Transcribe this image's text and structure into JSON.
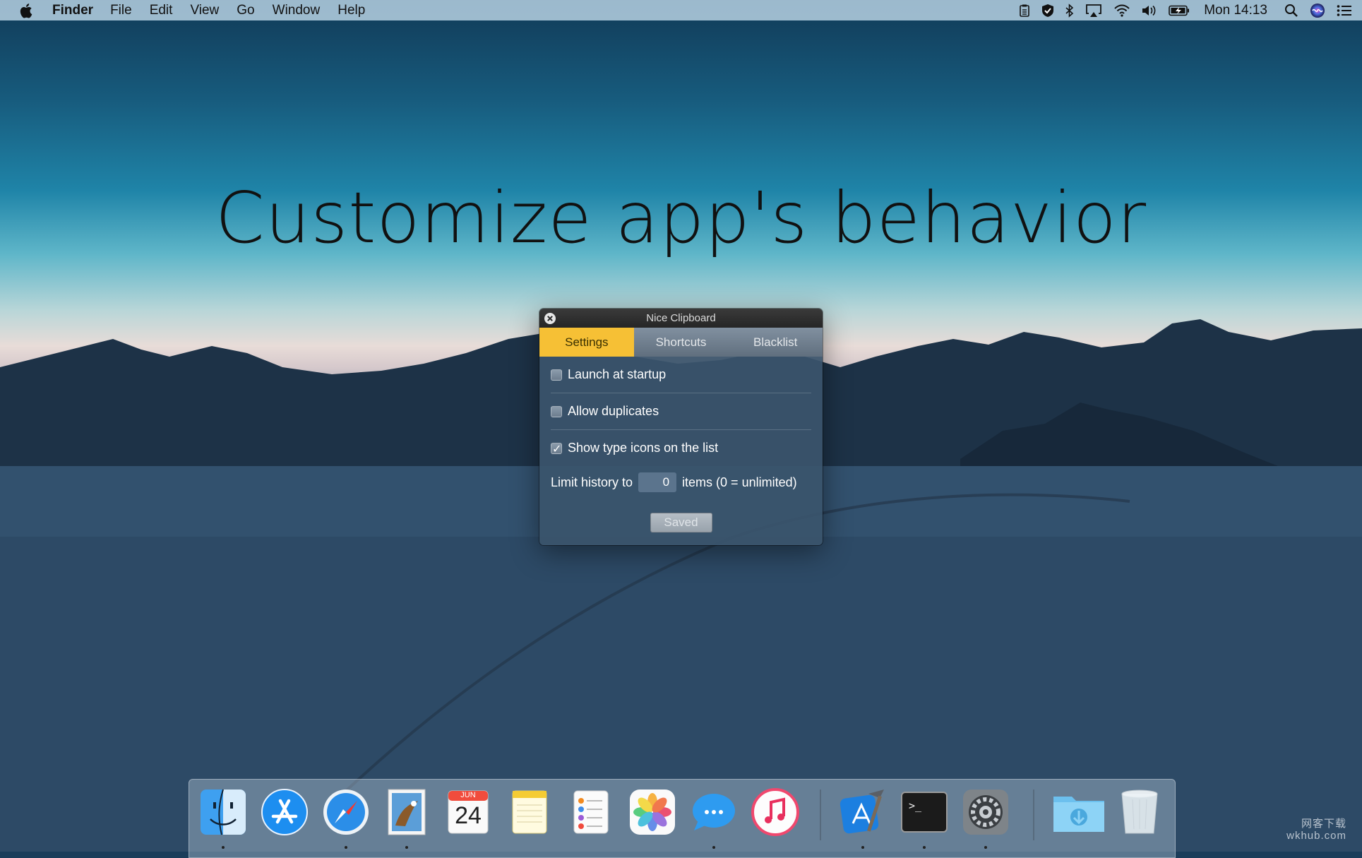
{
  "menubar": {
    "app_name": "Finder",
    "menus": [
      "File",
      "Edit",
      "View",
      "Go",
      "Window",
      "Help"
    ],
    "clock": "Mon 14:13"
  },
  "headline": "Customize app's behavior",
  "window": {
    "title": "Nice Clipboard",
    "tabs": [
      {
        "label": "Settings",
        "active": true
      },
      {
        "label": "Shortcuts",
        "active": false
      },
      {
        "label": "Blacklist",
        "active": false
      }
    ],
    "settings": [
      {
        "label": "Launch at startup",
        "checked": false
      },
      {
        "label": "Allow duplicates",
        "checked": false
      },
      {
        "label": "Show type icons on the list",
        "checked": true
      }
    ],
    "limit": {
      "prefix": "Limit history to",
      "value": "0",
      "suffix": "items (0 = unlimited)"
    },
    "saved_label": "Saved"
  },
  "dock": {
    "calendar_month": "JUN",
    "calendar_day": "24",
    "terminal_prompt": ">_"
  },
  "watermark": {
    "line1": "网客下载",
    "line2": "wkhub.com"
  },
  "colors": {
    "accent_tab": "#f6c035",
    "window_bg": "#3a546c"
  }
}
